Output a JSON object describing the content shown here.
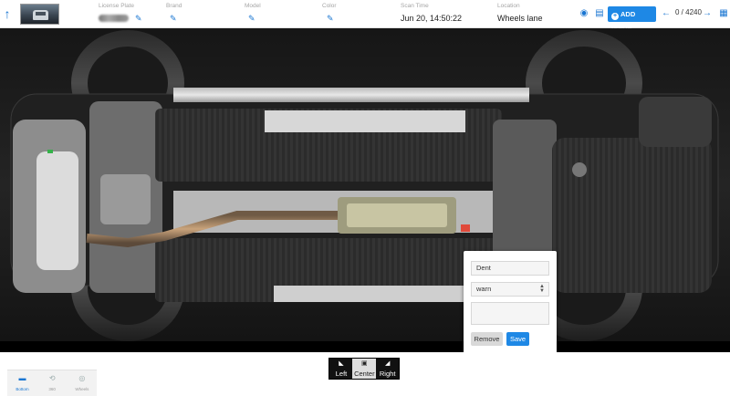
{
  "header": {
    "back_icon": "arrow-up-icon",
    "license_plate": {
      "label": "License Plate",
      "value": ""
    },
    "brand": {
      "label": "Brand",
      "value": ""
    },
    "model": {
      "label": "Model",
      "value": ""
    },
    "color": {
      "label": "Color",
      "value": ""
    },
    "scan_time": {
      "label": "Scan Time",
      "value": "Jun 20, 14:50:22"
    },
    "location": {
      "label": "Location",
      "value": "Wheels lane"
    },
    "add_issue_label": "ADD ISSUE",
    "counter": "0 / 4240"
  },
  "popup": {
    "issue_type": "Dent",
    "severity_selected": "warn",
    "notes": "",
    "remove_label": "Remove",
    "save_label": "Save"
  },
  "view_controls": {
    "left_label": "Left",
    "center_label": "Center",
    "right_label": "Right",
    "active": "Center"
  },
  "mode_tabs": [
    {
      "label": "Bottom",
      "icon": "car-bottom-icon",
      "active": true
    },
    {
      "label": "360",
      "icon": "car-360-icon",
      "active": false
    },
    {
      "label": "Wheels",
      "icon": "wheel-icon",
      "active": false
    }
  ],
  "colors": {
    "accent": "#1e88e5",
    "link": "#1976d2",
    "viewer_bg": "#0d0d0d"
  }
}
